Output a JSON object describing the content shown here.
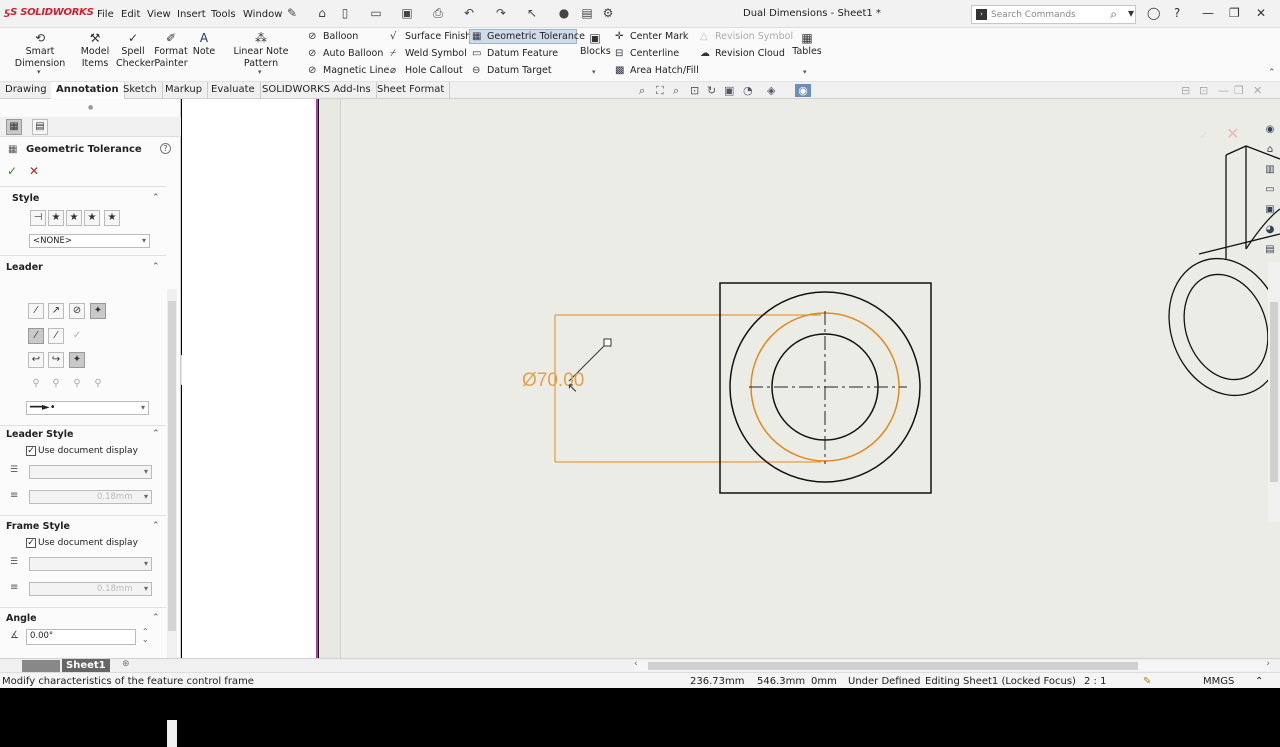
{
  "app": {
    "logo": "SOLIDWORKS",
    "doc_title": "Dual Dimensions - Sheet1 *"
  },
  "menu": [
    "File",
    "Edit",
    "View",
    "Insert",
    "Tools",
    "Window"
  ],
  "search": {
    "placeholder": "Search Commands"
  },
  "ribbon": {
    "smart_dimension": "Smart Dimension",
    "model_items_1": "Model",
    "model_items_2": "Items",
    "spell_1": "Spell",
    "spell_2": "Checker",
    "format_1": "Format",
    "format_2": "Painter",
    "note": "Note",
    "linear_note": "Linear Note Pattern",
    "balloon": "Balloon",
    "auto_balloon": "Auto Balloon",
    "magnetic_line": "Magnetic Line",
    "surface_finish": "Surface Finish",
    "weld_symbol": "Weld Symbol",
    "hole_callout": "Hole Callout",
    "geometric_tolerance": "Geometric Tolerance",
    "datum_feature": "Datum Feature",
    "datum_target": "Datum Target",
    "blocks": "Blocks",
    "center_mark": "Center Mark",
    "centerline": "Centerline",
    "area_hatch": "Area Hatch/Fill",
    "revision_symbol": "Revision Symbol",
    "revision_cloud": "Revision Cloud",
    "tables": "Tables"
  },
  "tabs": [
    "Drawing",
    "Annotation",
    "Sketch",
    "Markup",
    "Evaluate",
    "SOLIDWORKS Add-Ins",
    "Sheet Format"
  ],
  "active_tab": "Annotation",
  "panel": {
    "title": "Geometric Tolerance",
    "style_label": "Style",
    "style_value": "<NONE>",
    "leader_label": "Leader",
    "leader_style_label": "Leader Style",
    "use_doc_display": "Use document display",
    "thickness_value": "0.18mm",
    "frame_style_label": "Frame Style",
    "angle_label": "Angle",
    "angle_value": "0.00°"
  },
  "canvas": {
    "dimension_text": "Ø70.00"
  },
  "sheet_tab": "Sheet1",
  "status": {
    "message": "Modify characteristics of the feature control frame",
    "x": "236.73mm",
    "y": "546.3mm",
    "z": "0mm",
    "state": "Under Defined",
    "editing": "Editing Sheet1 (Locked Focus)",
    "scale": "2 : 1",
    "units": "MMGS"
  },
  "colors": {
    "accent_orange": "#e08a1e",
    "selection_purple": "#c030c0",
    "brand_red": "#d0202e"
  }
}
